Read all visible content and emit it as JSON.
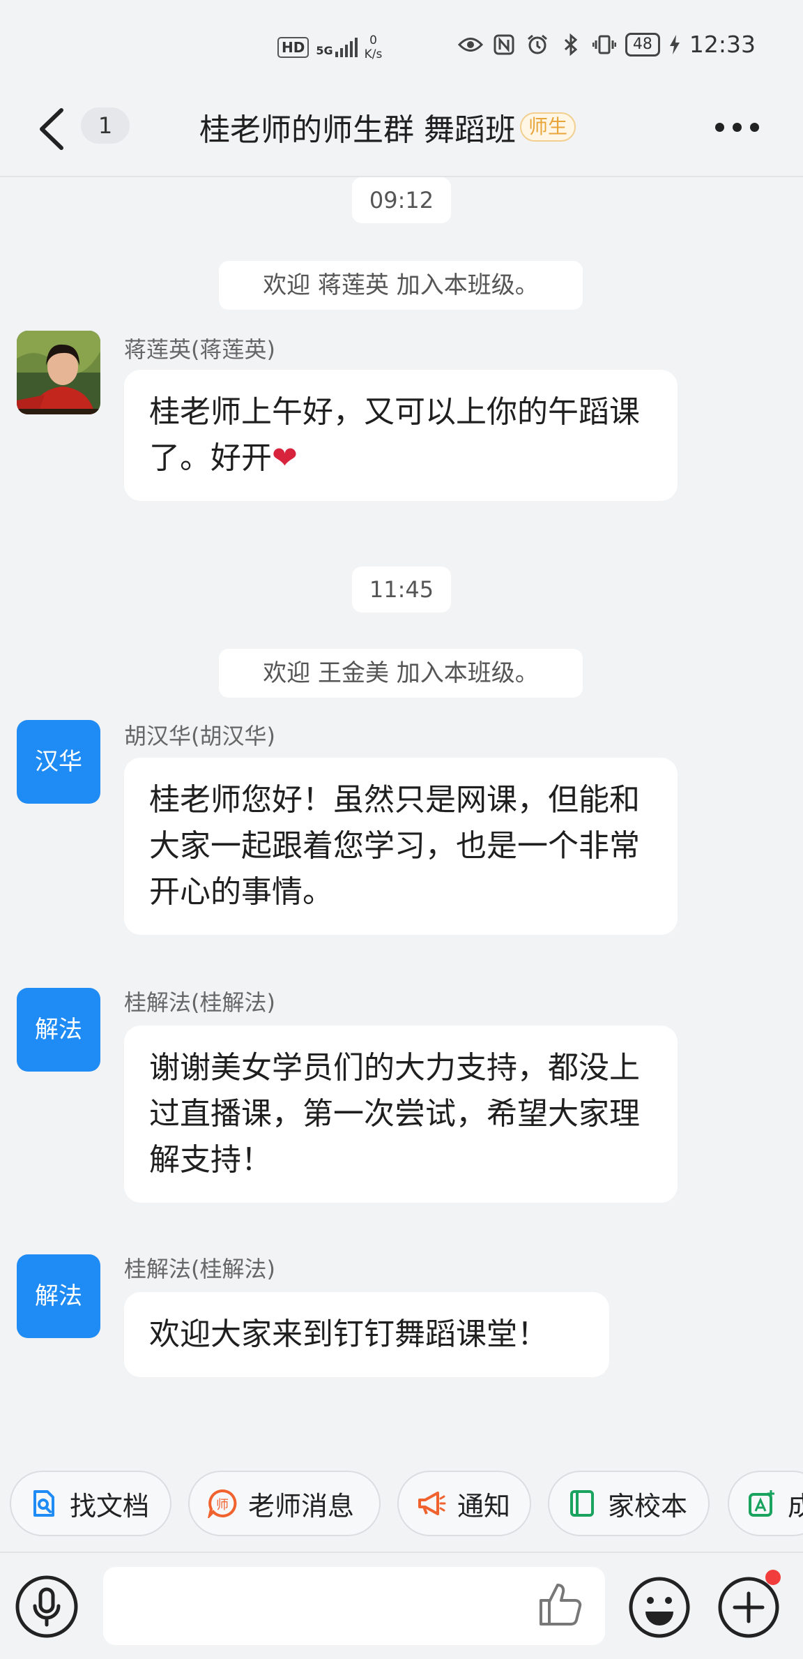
{
  "status_bar": {
    "hd": "HD",
    "signal": "5G",
    "speed_value": "0",
    "speed_unit": "K/s",
    "battery": "48",
    "time": "12:33"
  },
  "header": {
    "unread_count": "1",
    "title": "桂老师的师生群 舞蹈班",
    "role_badge": "师生"
  },
  "messages": {
    "time_1": "09:12",
    "system_1": "欢迎 蒋莲英 加入本班级。",
    "m1_sender": "蒋莲英(蒋莲英)",
    "m1_text": "桂老师上午好，又可以上你的午蹈课了。好开",
    "m1_emoji": "❤",
    "time_2": "11:45",
    "system_2": "欢迎 王金美 加入本班级。",
    "m2_avatar": "汉华",
    "m2_sender": "胡汉华(胡汉华)",
    "m2_text": "桂老师您好！虽然只是网课，但能和大家一起跟着您学习，也是一个非常开心的事情。",
    "m3_avatar": "解法",
    "m3_sender": "桂解法(桂解法)",
    "m3_text": "谢谢美女学员们的大力支持，都没上过直播课，第一次尝试，希望大家理解支持！",
    "m4_avatar": "解法",
    "m4_sender": "桂解法(桂解法)",
    "m4_text": "欢迎大家来到钉钉舞蹈课堂！"
  },
  "quick_actions": {
    "find_docs": "找文档",
    "teacher_msg": "老师消息",
    "notice": "通知",
    "home_school": "家校本",
    "cut_off": "成"
  },
  "colors": {
    "accent_blue": "#1f8bf5",
    "background": "#f2f3f5",
    "badge_orange": "#e8a63a",
    "notification_red": "#f23d3d"
  }
}
